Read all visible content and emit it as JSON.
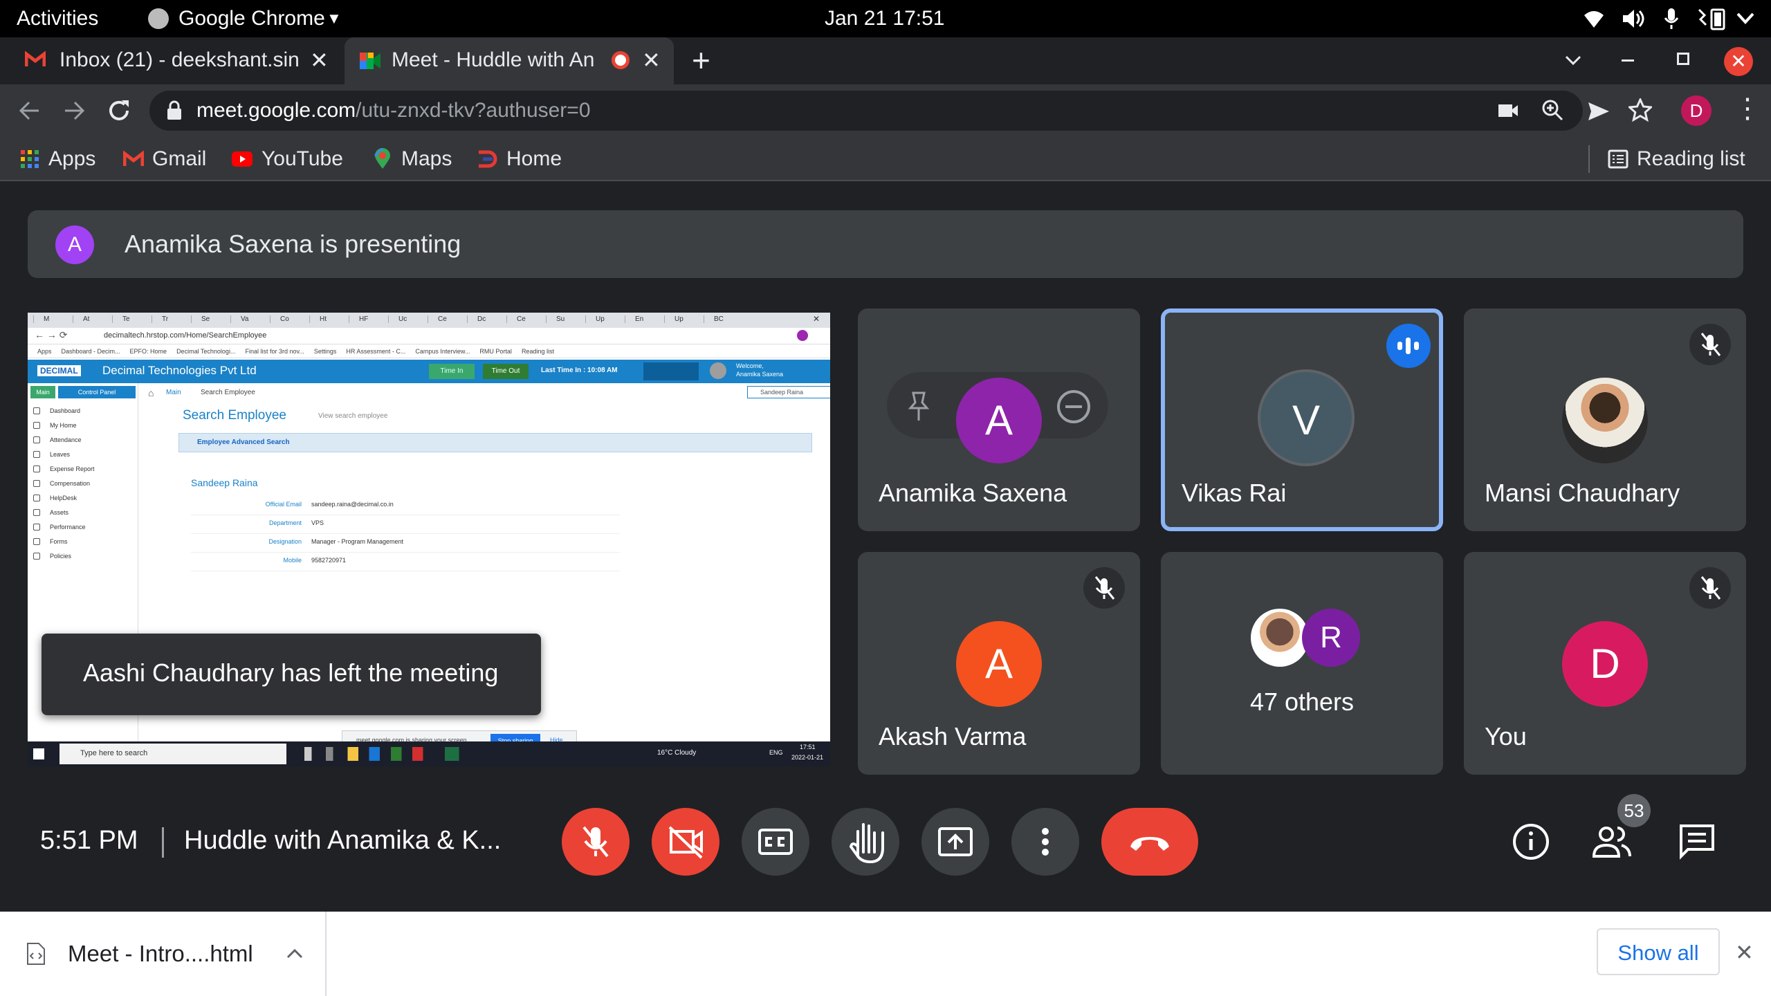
{
  "os": {
    "activities": "Activities",
    "app_name": "Google Chrome",
    "clock": "Jan 21  17:51"
  },
  "tabs": [
    {
      "label": "Inbox (21) - deekshant.sin"
    },
    {
      "label": "Meet - Huddle with An"
    }
  ],
  "address": {
    "host": "meet.google.com",
    "path": "/utu-znxd-tkv?authuser=0"
  },
  "profile_initial": "D",
  "bookmarks": [
    {
      "label": "Apps"
    },
    {
      "label": "Gmail"
    },
    {
      "label": "YouTube"
    },
    {
      "label": "Maps"
    },
    {
      "label": "Home"
    }
  ],
  "reading_list": "Reading list",
  "banner": {
    "initial": "A",
    "text": "Anamika Saxena is presenting"
  },
  "presentation": {
    "tabs": [
      "M",
      "At",
      "Te",
      "Tr",
      "Se",
      "Va",
      "Co",
      "Ht",
      "HF",
      "Uc",
      "Ce",
      "Dc",
      "Ce",
      "Su",
      "Up",
      "En",
      "Up",
      "BC"
    ],
    "url": "decimaltech.hrstop.com/Home/SearchEmployee",
    "bookmarks": [
      "Apps",
      "Dashboard - Decim...",
      "EPFO: Home",
      "Decimal Technologi...",
      "Final list for 3rd nov...",
      "Settings",
      "HR Assessment - C...",
      "Campus Interview...",
      "RMU Portal",
      "Reading list"
    ],
    "logo": "DECIMAL",
    "company": "Decimal Technologies Pvt Ltd",
    "btn_time_in": "Time In",
    "btn_time_out": "Time Out",
    "last_time": "Last Time In : 10:08 AM",
    "welcome_1": "Welcome,",
    "welcome_2": "Anamika Saxena",
    "tab_main": "Main",
    "tab_cp": "Control Panel",
    "crumb_main": "Main",
    "crumb_page": "Search Employee",
    "search_value": "Sandeep Raina",
    "side_items": [
      "Dashboard",
      "My Home",
      "Attendance",
      "Leaves",
      "Expense Report",
      "Compensation",
      "HelpDesk",
      "Assets",
      "Performance",
      "Forms",
      "Policies"
    ],
    "page_title": "Search Employee",
    "view_link": "View search employee",
    "section": "Employee Advanced Search",
    "emp_name": "Sandeep Raina",
    "fields": [
      {
        "k": "Official Email",
        "v": "sandeep.raina@decimal.co.in"
      },
      {
        "k": "Department",
        "v": "VPS"
      },
      {
        "k": "Designation",
        "v": "Manager - Program Management"
      },
      {
        "k": "Mobile",
        "v": "9582720971"
      }
    ],
    "share_text": "meet.google.com is sharing your screen.",
    "stop_sharing": "Stop sharing",
    "hide": "Hide",
    "taskbar_search": "Type here to search",
    "weather": "16°C  Cloudy",
    "lang": "ENG",
    "time": "17:51",
    "date": "2022-01-21"
  },
  "toast": "Aashi Chaudhary has left the meeting",
  "participants": [
    {
      "name": "Anamika Saxena",
      "initial": "A",
      "color": "#8e24aa"
    },
    {
      "name": "Vikas Rai",
      "initial": "V",
      "color": "#455a64"
    },
    {
      "name": "Mansi Chaudhary"
    },
    {
      "name": "Akash Varma",
      "initial": "A",
      "color": "#f4511e"
    },
    {
      "others": "47 others",
      "initial": "R",
      "color": "#7b1fa2"
    },
    {
      "name": "You",
      "initial": "D",
      "color": "#d81b60"
    }
  ],
  "meeting": {
    "time": "5:51 PM",
    "title": "Huddle with Anamika & K...",
    "people_count": "53"
  },
  "download": {
    "filename": "Meet - Intro....html",
    "show_all": "Show all"
  }
}
